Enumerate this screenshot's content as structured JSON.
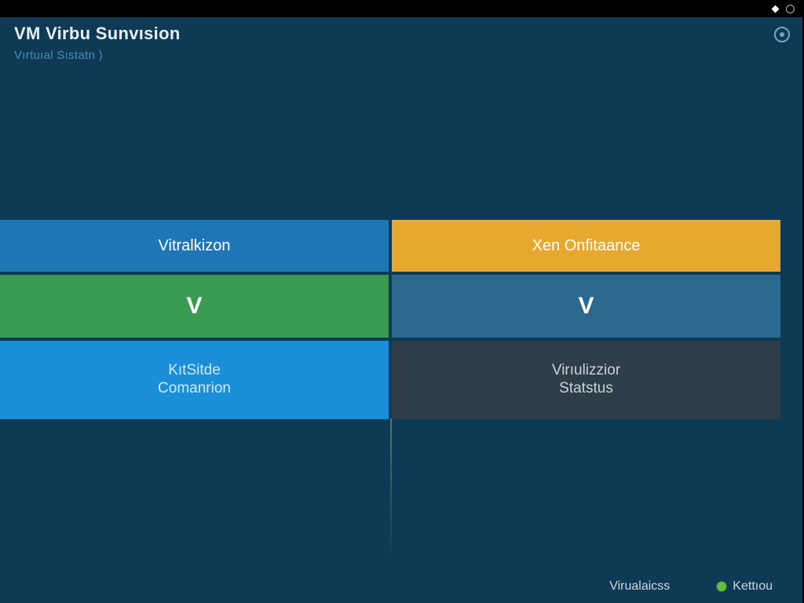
{
  "titlebar": {
    "icons": [
      "diamond",
      "ring"
    ]
  },
  "header": {
    "title": "VM Virbu Sunvısion",
    "subtitle": "Vırtuıal Sıstatn )"
  },
  "grid": {
    "tiles": [
      {
        "label": "Vitralkizon",
        "color": "c-blue",
        "size": "small"
      },
      {
        "label": "Xen Onfitaance",
        "color": "c-amber",
        "size": "small"
      },
      {
        "label": "V",
        "color": "c-green",
        "size": "big"
      },
      {
        "label": "V",
        "color": "c-steel",
        "size": "big"
      },
      {
        "label": "KıtSitde\nComanrion",
        "color": "c-brightblue",
        "size": "multi"
      },
      {
        "label": "Virıulizzior\nStatstus",
        "color": "c-slate",
        "size": "multi"
      }
    ]
  },
  "footer": {
    "left_label": "Virualaicss",
    "right_label": "Kettıou"
  }
}
